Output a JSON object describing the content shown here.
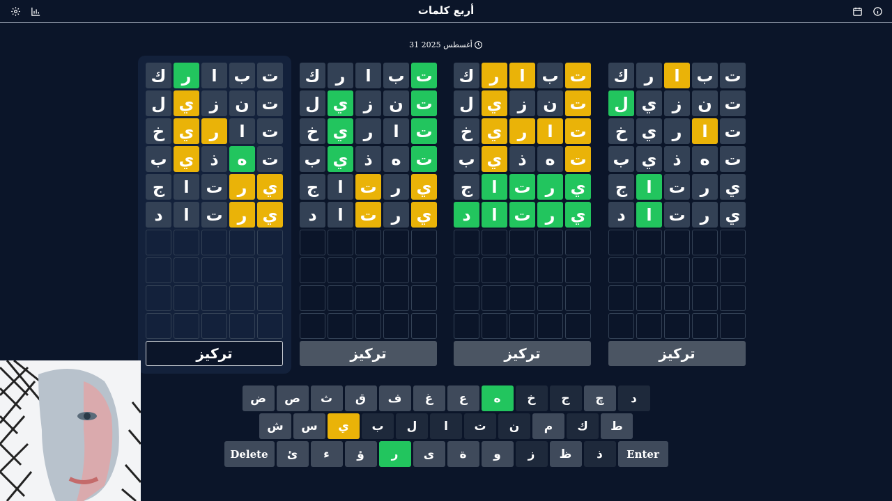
{
  "header": {
    "title": "أربع كلمات"
  },
  "date": "31 أغسطس 2025",
  "focus_label": "تركيز",
  "boards": [
    {
      "active": true,
      "rows": [
        [
          [
            "ت",
            "n"
          ],
          [
            "ب",
            "n"
          ],
          [
            "ا",
            "n"
          ],
          [
            "ر",
            "g"
          ],
          [
            "ك",
            "n"
          ]
        ],
        [
          [
            "ت",
            "n"
          ],
          [
            "ن",
            "n"
          ],
          [
            "ز",
            "n"
          ],
          [
            "ي",
            "y"
          ],
          [
            "ل",
            "n"
          ]
        ],
        [
          [
            "ت",
            "n"
          ],
          [
            "ا",
            "n"
          ],
          [
            "ر",
            "y"
          ],
          [
            "ي",
            "y"
          ],
          [
            "خ",
            "n"
          ]
        ],
        [
          [
            "ت",
            "n"
          ],
          [
            "ه",
            "g"
          ],
          [
            "ذ",
            "n"
          ],
          [
            "ي",
            "y"
          ],
          [
            "ب",
            "n"
          ]
        ],
        [
          [
            "ي",
            "y"
          ],
          [
            "ر",
            "y"
          ],
          [
            "ت",
            "n"
          ],
          [
            "ا",
            "n"
          ],
          [
            "ج",
            "n"
          ]
        ],
        [
          [
            "ي",
            "y"
          ],
          [
            "ر",
            "y"
          ],
          [
            "ت",
            "n"
          ],
          [
            "ا",
            "n"
          ],
          [
            "د",
            "n"
          ]
        ]
      ]
    },
    {
      "active": false,
      "rows": [
        [
          [
            "ت",
            "g"
          ],
          [
            "ب",
            "n"
          ],
          [
            "ا",
            "n"
          ],
          [
            "ر",
            "n"
          ],
          [
            "ك",
            "n"
          ]
        ],
        [
          [
            "ت",
            "g"
          ],
          [
            "ن",
            "n"
          ],
          [
            "ز",
            "n"
          ],
          [
            "ي",
            "g"
          ],
          [
            "ل",
            "n"
          ]
        ],
        [
          [
            "ت",
            "g"
          ],
          [
            "ا",
            "n"
          ],
          [
            "ر",
            "n"
          ],
          [
            "ي",
            "g"
          ],
          [
            "خ",
            "n"
          ]
        ],
        [
          [
            "ت",
            "g"
          ],
          [
            "ه",
            "n"
          ],
          [
            "ذ",
            "n"
          ],
          [
            "ي",
            "g"
          ],
          [
            "ب",
            "n"
          ]
        ],
        [
          [
            "ي",
            "y"
          ],
          [
            "ر",
            "n"
          ],
          [
            "ت",
            "y"
          ],
          [
            "ا",
            "n"
          ],
          [
            "ج",
            "n"
          ]
        ],
        [
          [
            "ي",
            "y"
          ],
          [
            "ر",
            "n"
          ],
          [
            "ت",
            "y"
          ],
          [
            "ا",
            "n"
          ],
          [
            "د",
            "n"
          ]
        ]
      ]
    },
    {
      "active": false,
      "rows": [
        [
          [
            "ت",
            "y"
          ],
          [
            "ب",
            "n"
          ],
          [
            "ا",
            "y"
          ],
          [
            "ر",
            "y"
          ],
          [
            "ك",
            "n"
          ]
        ],
        [
          [
            "ت",
            "y"
          ],
          [
            "ن",
            "n"
          ],
          [
            "ز",
            "n"
          ],
          [
            "ي",
            "y"
          ],
          [
            "ل",
            "n"
          ]
        ],
        [
          [
            "ت",
            "y"
          ],
          [
            "ا",
            "y"
          ],
          [
            "ر",
            "y"
          ],
          [
            "ي",
            "y"
          ],
          [
            "خ",
            "n"
          ]
        ],
        [
          [
            "ت",
            "y"
          ],
          [
            "ه",
            "n"
          ],
          [
            "ذ",
            "n"
          ],
          [
            "ي",
            "y"
          ],
          [
            "ب",
            "n"
          ]
        ],
        [
          [
            "ي",
            "g"
          ],
          [
            "ر",
            "g"
          ],
          [
            "ت",
            "g"
          ],
          [
            "ا",
            "g"
          ],
          [
            "ج",
            "n"
          ]
        ],
        [
          [
            "ي",
            "g"
          ],
          [
            "ر",
            "g"
          ],
          [
            "ت",
            "g"
          ],
          [
            "ا",
            "g"
          ],
          [
            "د",
            "g"
          ]
        ]
      ]
    },
    {
      "active": false,
      "rows": [
        [
          [
            "ت",
            "n"
          ],
          [
            "ب",
            "n"
          ],
          [
            "ا",
            "y"
          ],
          [
            "ر",
            "n"
          ],
          [
            "ك",
            "n"
          ]
        ],
        [
          [
            "ت",
            "n"
          ],
          [
            "ن",
            "n"
          ],
          [
            "ز",
            "n"
          ],
          [
            "ي",
            "n"
          ],
          [
            "ل",
            "g"
          ]
        ],
        [
          [
            "ت",
            "n"
          ],
          [
            "ا",
            "y"
          ],
          [
            "ر",
            "n"
          ],
          [
            "ي",
            "n"
          ],
          [
            "خ",
            "n"
          ]
        ],
        [
          [
            "ت",
            "n"
          ],
          [
            "ه",
            "n"
          ],
          [
            "ذ",
            "n"
          ],
          [
            "ي",
            "n"
          ],
          [
            "ب",
            "n"
          ]
        ],
        [
          [
            "ي",
            "n"
          ],
          [
            "ر",
            "n"
          ],
          [
            "ت",
            "n"
          ],
          [
            "ا",
            "g"
          ],
          [
            "ج",
            "n"
          ]
        ],
        [
          [
            "ي",
            "n"
          ],
          [
            "ر",
            "n"
          ],
          [
            "ت",
            "n"
          ],
          [
            "ا",
            "g"
          ],
          [
            "د",
            "n"
          ]
        ]
      ]
    }
  ],
  "keyboard": [
    [
      [
        "د",
        "d"
      ],
      [
        "چ",
        "n"
      ],
      [
        "ج",
        "d"
      ],
      [
        "خ",
        "d"
      ],
      [
        "ه",
        "g"
      ],
      [
        "ع",
        "n"
      ],
      [
        "غ",
        "n"
      ],
      [
        "ف",
        "n"
      ],
      [
        "ق",
        "n"
      ],
      [
        "ث",
        "n"
      ],
      [
        "ص",
        "n"
      ],
      [
        "ض",
        "n"
      ]
    ],
    [
      [
        "ط",
        "n"
      ],
      [
        "ك",
        "d"
      ],
      [
        "م",
        "n"
      ],
      [
        "ن",
        "d"
      ],
      [
        "ت",
        "d"
      ],
      [
        "ا",
        "d"
      ],
      [
        "ل",
        "d"
      ],
      [
        "ب",
        "d"
      ],
      [
        "ي",
        "y"
      ],
      [
        "س",
        "n"
      ],
      [
        "ش",
        "n"
      ]
    ],
    [
      [
        "Enter",
        "w"
      ],
      [
        "ذ",
        "d"
      ],
      [
        "ظ",
        "n"
      ],
      [
        "ز",
        "d"
      ],
      [
        "و",
        "n"
      ],
      [
        "ة",
        "n"
      ],
      [
        "ى",
        "n"
      ],
      [
        "ر",
        "g"
      ],
      [
        "ؤ",
        "n"
      ],
      [
        "ء",
        "n"
      ],
      [
        "ئ",
        "n"
      ],
      [
        "Delete",
        "w"
      ]
    ]
  ]
}
